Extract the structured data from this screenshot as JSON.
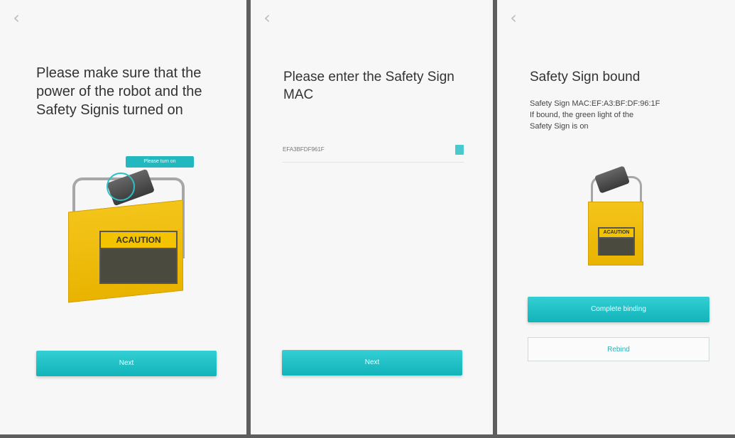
{
  "screen1": {
    "title_line1": "Please make sure that the",
    "title_line2": "power of the robot and the",
    "title_line3": "Safety Signis turned on",
    "tooltip": "Please turn on",
    "caution_text": "ACAUTION",
    "next_label": "Next"
  },
  "screen2": {
    "title_line1": "Please enter the Safety Sign",
    "title_line2": "MAC",
    "mac_value": "EFA3BFDF961F",
    "next_label": "Next"
  },
  "screen3": {
    "title": "Safety Sign bound",
    "mac_line": "Safety Sign MAC:EF:A3:BF:DF:96:1F",
    "info_line1": "If bound, the green light of the",
    "info_line2": "Safety Sign is on",
    "caution_text": "ACAUTION",
    "complete_label": "Complete binding",
    "rebind_label": "Rebind"
  },
  "icons": {
    "back": "chevron-left-icon",
    "scan": "scan-icon"
  },
  "colors": {
    "accent": "#1fbdc2",
    "caution_yellow": "#f0c000"
  }
}
